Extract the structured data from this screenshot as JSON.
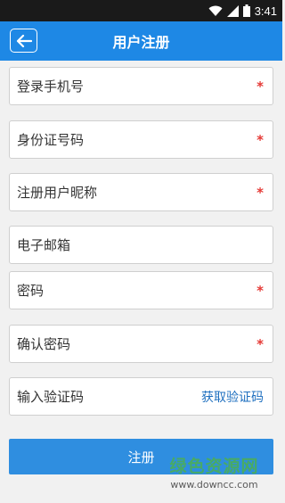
{
  "status_bar": {
    "time": "3:41",
    "icons": [
      "wifi-icon",
      "signal-icon",
      "battery-icon"
    ]
  },
  "header": {
    "title": "用户注册",
    "back_icon": "arrow-left-icon"
  },
  "form": {
    "required_mark": "*",
    "fields": [
      {
        "label": "登录手机号",
        "required": true
      },
      {
        "label": "身份证号码",
        "required": true
      },
      {
        "label": "注册用户昵称",
        "required": true
      },
      {
        "label": "电子邮箱",
        "required": false
      },
      {
        "label": "密码",
        "required": true
      },
      {
        "label": "确认密码",
        "required": true
      },
      {
        "label": "输入验证码",
        "required": false
      }
    ],
    "get_code_label": "获取验证码",
    "submit_label": "注册"
  },
  "watermark": {
    "text": "绿色资源网",
    "url": "www.downcc.com"
  },
  "colors": {
    "primary": "#1e88e5",
    "required": "#e53935",
    "link": "#1e6fbf"
  }
}
